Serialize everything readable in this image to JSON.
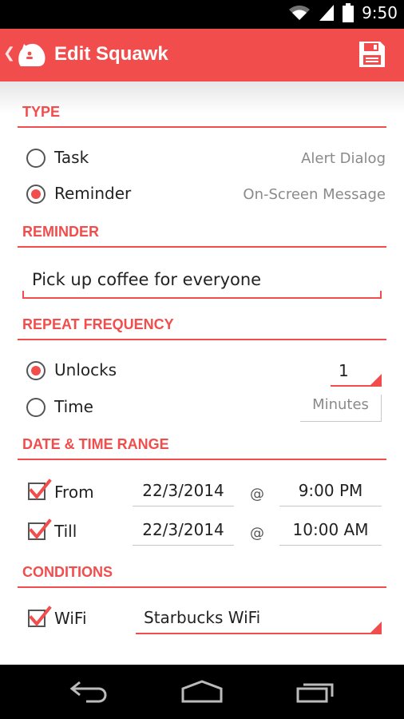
{
  "status_bar": {
    "time": "9:50",
    "icons": [
      "wifi-icon",
      "signal-icon",
      "battery-icon"
    ]
  },
  "app_bar": {
    "title": "Edit Squawk",
    "back_icon": "chevron-left-icon",
    "logo_icon": "bird-logo-icon",
    "save_icon": "save-icon"
  },
  "type_section": {
    "header": "TYPE",
    "options": [
      {
        "label": "Task",
        "hint": "Alert Dialog",
        "selected": false
      },
      {
        "label": "Reminder",
        "hint": "On-Screen Message",
        "selected": true
      }
    ]
  },
  "reminder_section": {
    "header": "REMINDER",
    "value": "Pick up coffee for everyone"
  },
  "repeat_section": {
    "header": "REPEAT FREQUENCY",
    "options": [
      {
        "label": "Unlocks",
        "value": "1",
        "selected": true
      },
      {
        "label": "Time",
        "value": "Minutes",
        "selected": false
      }
    ]
  },
  "date_section": {
    "header": "DATE & TIME RANGE",
    "at_symbol": "@",
    "rows": [
      {
        "label": "From",
        "date": "22/3/2014",
        "time": "9:00 PM",
        "checked": true
      },
      {
        "label": "Till",
        "date": "22/3/2014",
        "time": "10:00 AM",
        "checked": true
      }
    ]
  },
  "conditions_section": {
    "header": "CONDITIONS",
    "wifi": {
      "label": "WiFi",
      "value": "Starbucks WiFi",
      "checked": true
    }
  },
  "colors": {
    "accent": "#f24d4d",
    "text": "#222222",
    "hint": "#8a8a8a"
  },
  "nav_bar": {
    "icons": [
      "back-icon",
      "home-icon",
      "recent-apps-icon"
    ]
  }
}
